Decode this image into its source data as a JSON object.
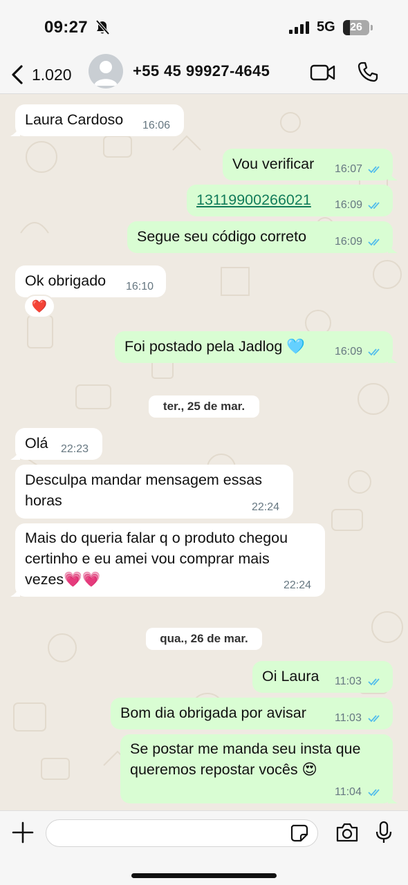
{
  "status_bar": {
    "time": "09:27",
    "network": "5G",
    "battery": "26",
    "battery_level_percent": 26,
    "icons": [
      "bell-slash-icon",
      "signal-icon",
      "battery-icon"
    ]
  },
  "header": {
    "back_count": "1.020",
    "contact": "+55 45 99927-4645",
    "icons": [
      "chevron-left-icon",
      "avatar-icon",
      "video-call-icon",
      "phone-icon"
    ]
  },
  "messages": [
    {
      "dir": "in",
      "text": "Laura Cardoso",
      "time": "16:06"
    },
    {
      "dir": "out",
      "text": "Vou verificar",
      "time": "16:07",
      "status": "read"
    },
    {
      "dir": "out",
      "text": "13119900266021",
      "time": "16:09",
      "status": "read",
      "link": true
    },
    {
      "dir": "out",
      "text": "Segue seu código correto",
      "time": "16:09",
      "status": "read"
    },
    {
      "dir": "in",
      "text": "Ok obrigado",
      "time": "16:10",
      "reaction": "❤️"
    },
    {
      "dir": "out",
      "text": "Foi postado pela Jadlog 🩵",
      "time": "16:09",
      "status": "read"
    },
    {
      "dir": "in",
      "text": "Olá",
      "time": "22:23"
    },
    {
      "dir": "in",
      "line1": "Desculpa mandar mensagem essas",
      "line2": "horas",
      "time": "22:24"
    },
    {
      "dir": "in",
      "line1": "Mais do queria falar q o produto chegou",
      "line2": "certinho e eu amei vou comprar mais",
      "line3": "vezes💗💗",
      "time": "22:24"
    },
    {
      "dir": "out",
      "text": "Oi Laura",
      "time": "11:03",
      "status": "read"
    },
    {
      "dir": "out",
      "text": "Bom dia obrigada por avisar",
      "time": "11:03",
      "status": "read"
    },
    {
      "dir": "out",
      "line1": "Se postar me manda seu insta que",
      "line2": "queremos repostar vocês 😍",
      "time": "11:04",
      "status": "read"
    }
  ],
  "date_chips": [
    "ter., 25 de mar.",
    "qua., 26 de mar."
  ],
  "input": {
    "value": "",
    "placeholder": "",
    "icons": [
      "plus-icon",
      "sticker-icon",
      "camera-icon",
      "microphone-icon"
    ]
  },
  "colors": {
    "outgoing_bubble": "#d9fdd3",
    "incoming_bubble": "#ffffff",
    "chat_background": "#efeae2",
    "read_ticks": "#53bdeb",
    "link": "#127c5a"
  }
}
